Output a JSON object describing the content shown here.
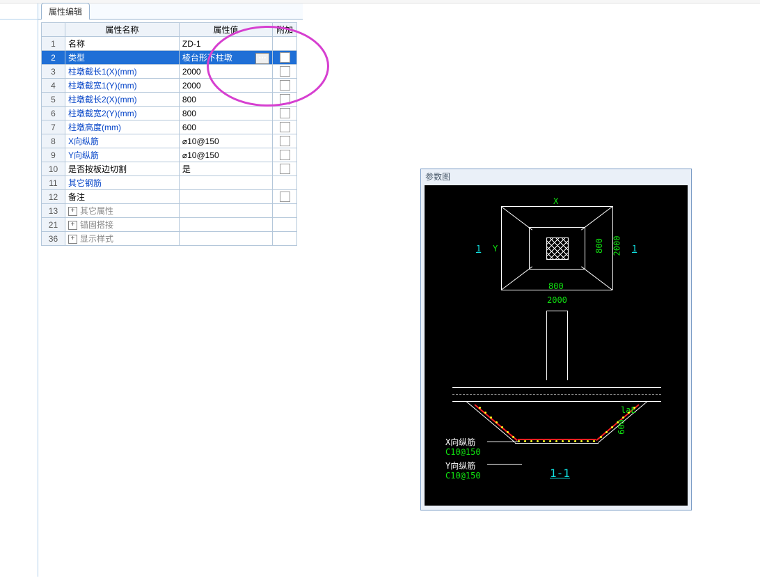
{
  "tab_label": "属性编辑",
  "search_placeholder": "",
  "headers": {
    "name": "属性名称",
    "value": "属性值",
    "add": "附加"
  },
  "rows": [
    {
      "idx": "1",
      "name": "名称",
      "val": "ZD-1",
      "link": false,
      "chk": false,
      "exp": false
    },
    {
      "idx": "2",
      "name": "类型",
      "val": "棱台形下柱墩",
      "link": false,
      "chk": true,
      "exp": false,
      "sel": true,
      "btn": true
    },
    {
      "idx": "3",
      "name": "柱墩截长1(X)(mm)",
      "val": "2000",
      "link": true,
      "chk": true,
      "exp": false
    },
    {
      "idx": "4",
      "name": "柱墩截宽1(Y)(mm)",
      "val": "2000",
      "link": true,
      "chk": true,
      "exp": false
    },
    {
      "idx": "5",
      "name": "柱墩截长2(X)(mm)",
      "val": "800",
      "link": true,
      "chk": true,
      "exp": false
    },
    {
      "idx": "6",
      "name": "柱墩截宽2(Y)(mm)",
      "val": "800",
      "link": true,
      "chk": true,
      "exp": false
    },
    {
      "idx": "7",
      "name": "柱墩高度(mm)",
      "val": "600",
      "link": true,
      "chk": true,
      "exp": false
    },
    {
      "idx": "8",
      "name": "X向纵筋",
      "val": "⌀10@150",
      "link": true,
      "chk": true,
      "exp": false
    },
    {
      "idx": "9",
      "name": "Y向纵筋",
      "val": "⌀10@150",
      "link": true,
      "chk": true,
      "exp": false
    },
    {
      "idx": "10",
      "name": "是否按板边切割",
      "val": "是",
      "link": false,
      "chk": true,
      "exp": false
    },
    {
      "idx": "11",
      "name": "其它钢筋",
      "val": "",
      "link": true,
      "chk": false,
      "exp": false
    },
    {
      "idx": "12",
      "name": "备注",
      "val": "",
      "link": false,
      "chk": true,
      "exp": false
    },
    {
      "idx": "13",
      "name": "其它属性",
      "val": "",
      "link": false,
      "chk": false,
      "exp": true,
      "gray": true
    },
    {
      "idx": "21",
      "name": "锚固搭接",
      "val": "",
      "link": false,
      "chk": false,
      "exp": true,
      "gray": true
    },
    {
      "idx": "36",
      "name": "显示样式",
      "val": "",
      "link": false,
      "chk": false,
      "exp": true,
      "gray": true
    }
  ],
  "diagram": {
    "title": "参数图",
    "dim_x_top": "X",
    "dim_y_left": "Y",
    "inner_w": "800",
    "inner_h": "800",
    "outer_w": "2000",
    "outer_h": "2000",
    "sec_left": "1",
    "sec_right": "1",
    "laE": "laE",
    "depth": "600",
    "x_rebar_label": "X向纵筋",
    "x_rebar_spec": "C10@150",
    "y_rebar_label": "Y向纵筋",
    "y_rebar_spec": "C10@150",
    "section_label": "1-1"
  }
}
